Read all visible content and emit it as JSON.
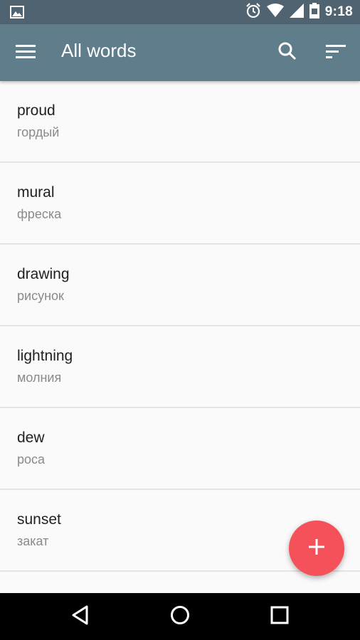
{
  "status_bar": {
    "time": "9:18",
    "icons": [
      "image-icon",
      "alarm-icon",
      "wifi-icon",
      "sim-icon",
      "battery-icon"
    ]
  },
  "app_bar": {
    "title": "All words",
    "icons": [
      "menu-icon",
      "search-icon",
      "sort-icon"
    ],
    "color": "#607d8b"
  },
  "words": [
    {
      "word": "proud",
      "translation": "гордый"
    },
    {
      "word": "mural",
      "translation": "фреска"
    },
    {
      "word": "drawing",
      "translation": "рисунок"
    },
    {
      "word": "lightning",
      "translation": "молния"
    },
    {
      "word": "dew",
      "translation": "роса"
    },
    {
      "word": "sunset",
      "translation": "закат"
    }
  ],
  "fab": {
    "icon": "add-icon",
    "color": "#f4515b"
  },
  "nav_bar": {
    "icons": [
      "back-icon",
      "home-icon",
      "recents-icon"
    ]
  }
}
